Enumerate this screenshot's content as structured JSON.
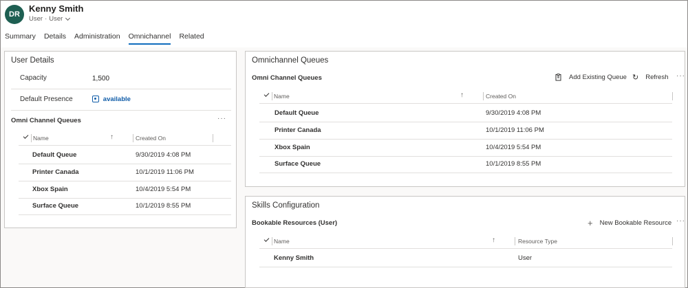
{
  "header": {
    "avatar_initials": "DR",
    "avatar_color": "#1e5f52",
    "name": "Kenny Smith",
    "entity": "User",
    "form": "User"
  },
  "tabs": [
    {
      "label": "Summary"
    },
    {
      "label": "Details"
    },
    {
      "label": "Administration"
    },
    {
      "label": "Omnichannel"
    },
    {
      "label": "Related"
    }
  ],
  "active_tab": "Omnichannel",
  "user_details": {
    "title": "User Details",
    "capacity_label": "Capacity",
    "capacity_value": "1,500",
    "presence_label": "Default Presence",
    "presence_value": "available",
    "grid_title": "Omni Channel Queues",
    "columns": [
      "Name",
      "Created On"
    ],
    "rows": [
      {
        "name": "Default Queue",
        "created": "9/30/2019 4:08 PM"
      },
      {
        "name": "Printer Canada",
        "created": "10/1/2019 11:06 PM"
      },
      {
        "name": "Xbox Spain",
        "created": "10/4/2019 5:54 PM"
      },
      {
        "name": "Surface Queue",
        "created": "10/1/2019 8:55 PM"
      }
    ]
  },
  "omni_queues": {
    "title": "Omnichannel Queues",
    "grid_title": "Omni Channel Queues",
    "add_label": "Add Existing Queue",
    "refresh_label": "Refresh",
    "columns": [
      "Name",
      "Created On"
    ],
    "rows": [
      {
        "name": "Default Queue",
        "created": "9/30/2019 4:08 PM"
      },
      {
        "name": "Printer Canada",
        "created": "10/1/2019 11:06 PM"
      },
      {
        "name": "Xbox Spain",
        "created": "10/4/2019 5:54 PM"
      },
      {
        "name": "Surface Queue",
        "created": "10/1/2019 8:55 PM"
      }
    ]
  },
  "skills": {
    "title": "Skills Configuration",
    "grid_title": "Bookable Resources (User)",
    "new_label": "New Bookable Resource",
    "columns": [
      "Name",
      "Resource Type"
    ],
    "rows": [
      {
        "name": "Kenny Smith",
        "type": "User"
      }
    ]
  },
  "glyphs": {
    "more": "···",
    "sort_up": "↑",
    "plus": "+",
    "refresh": "↻",
    "dot": "·"
  },
  "icons": [
    "checkmark-icon",
    "sort-ascending-icon",
    "more-options-icon",
    "add-existing-icon",
    "refresh-icon",
    "plus-icon",
    "presence-icon",
    "chevron-down-icon"
  ]
}
